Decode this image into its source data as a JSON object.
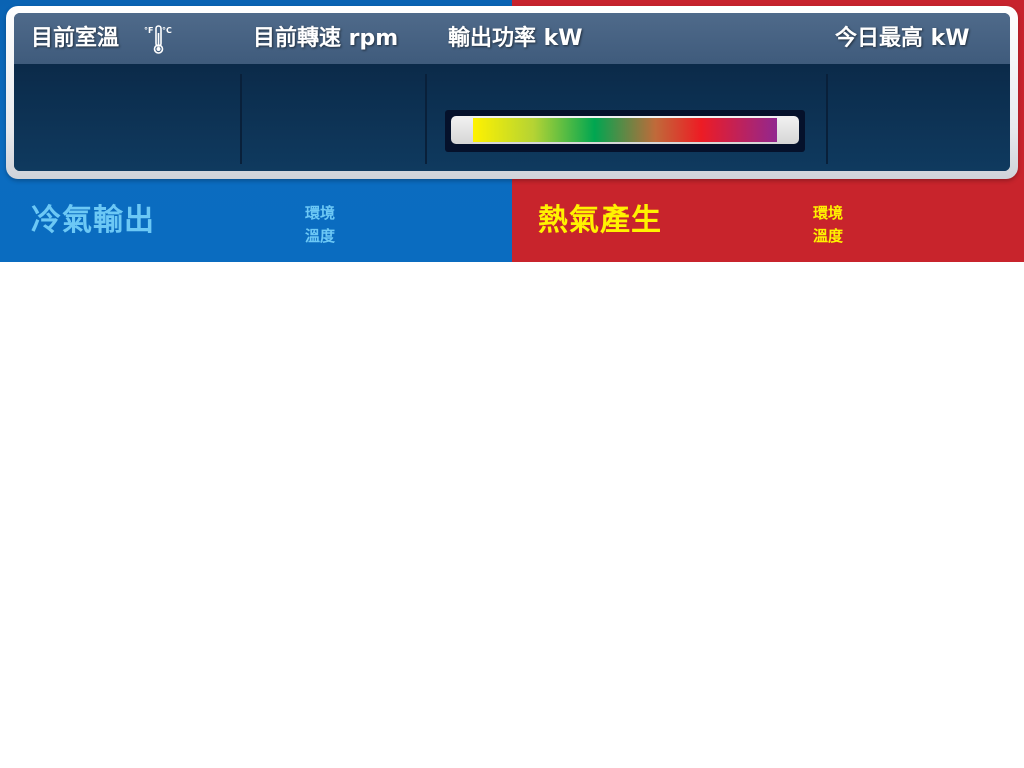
{
  "colors": {
    "cool_bg": "#0b6cc0",
    "warm_bg": "#c8242c",
    "cool_text": "#6cc8f5",
    "warm_text": "#fff200",
    "header_text": "#ffffff"
  },
  "header": {
    "room_temp_label": "目前室溫",
    "thermometer_icon": "thermometer-icon",
    "unit_f": "°F",
    "unit_c": "°C",
    "speed_label": "目前轉速 rpm",
    "power_label": "輸出功率 kW",
    "today_max_label": "今日最高 kW"
  },
  "legend": {
    "cool_title": "冷氣輸出",
    "cool_sub_line1": "環境",
    "cool_sub_line2": "溫度",
    "heat_title": "熱氣產生",
    "heat_sub_line1": "環境",
    "heat_sub_line2": "溫度"
  }
}
